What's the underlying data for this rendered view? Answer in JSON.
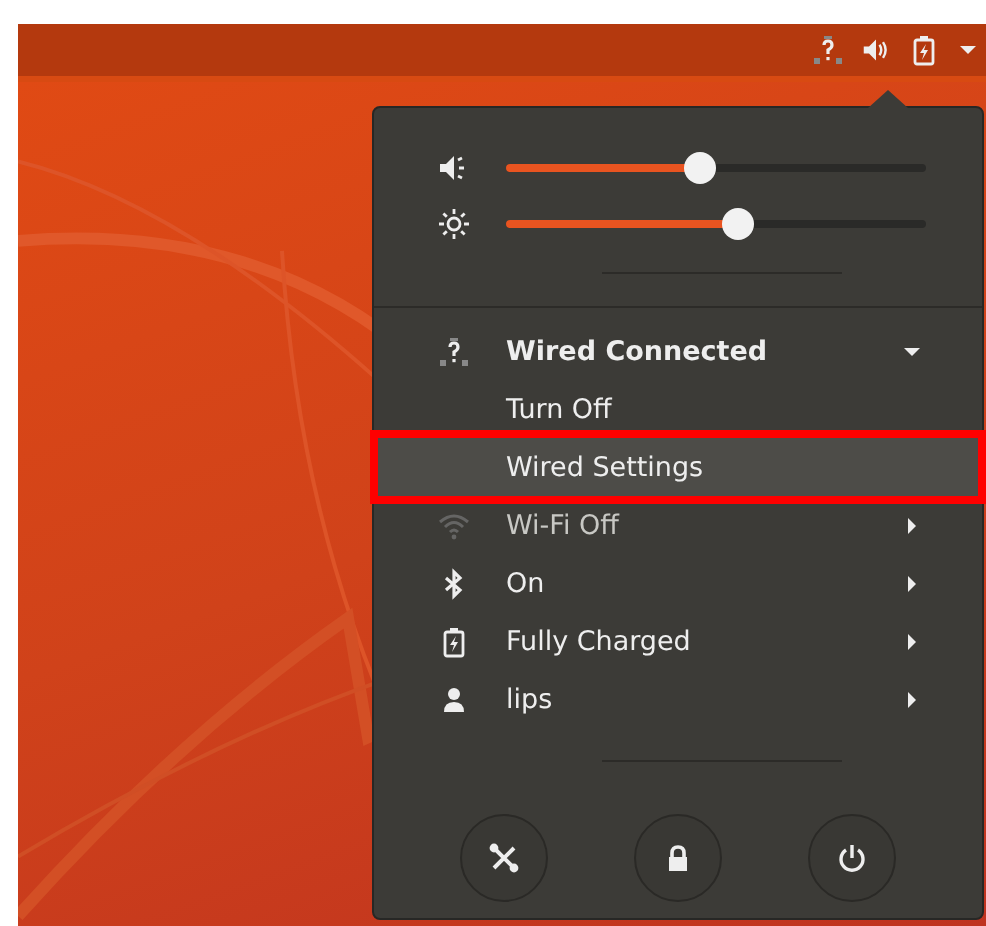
{
  "sliders": [
    {
      "kind": "volume",
      "level": 0.46
    },
    {
      "kind": "brightness",
      "level": 0.55
    }
  ],
  "menu_items": [
    {
      "kind": "network",
      "label": "Wired Connected",
      "expanded": true,
      "highlighted": false,
      "outlined": false,
      "disabled": false
    },
    {
      "kind": "action",
      "label": "Turn Off",
      "highlighted": false,
      "outlined": false,
      "disabled": false
    },
    {
      "kind": "action",
      "label": "Wired Settings",
      "highlighted": true,
      "outlined": true,
      "disabled": false
    },
    {
      "kind": "wifi",
      "label": "Wi-Fi Off",
      "highlighted": false,
      "outlined": false,
      "disabled": true
    },
    {
      "kind": "bluetooth",
      "label": "On",
      "highlighted": false,
      "outlined": false,
      "disabled": false
    },
    {
      "kind": "battery",
      "label": "Fully Charged",
      "highlighted": false,
      "outlined": false,
      "disabled": false
    },
    {
      "kind": "user",
      "label": "lips",
      "highlighted": false,
      "outlined": false,
      "disabled": false
    }
  ],
  "action_buttons": [
    {
      "kind": "settings"
    },
    {
      "kind": "lock"
    },
    {
      "kind": "power"
    }
  ]
}
